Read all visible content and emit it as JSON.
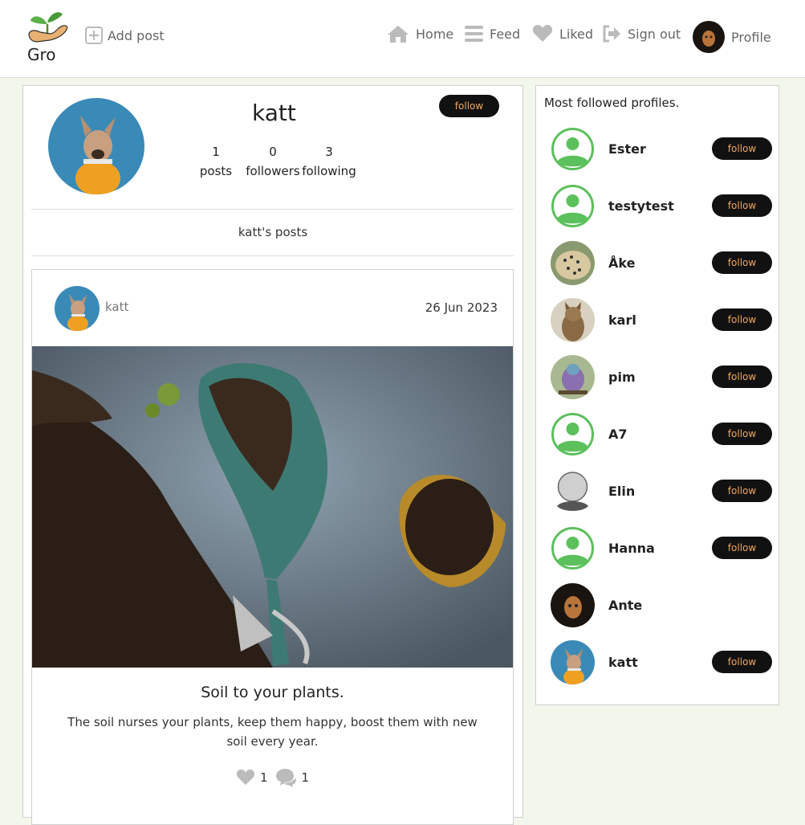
{
  "nav": {
    "logo_text": "Gro",
    "add_post": "Add post",
    "home": "Home",
    "feed": "Feed",
    "liked": "Liked",
    "sign_out": "Sign out",
    "profile": "Profile"
  },
  "profile": {
    "username": "katt",
    "follow_label": "follow",
    "stats": [
      {
        "value": "1",
        "label": "posts"
      },
      {
        "value": "0",
        "label": "followers"
      },
      {
        "value": "3",
        "label": "following"
      }
    ],
    "posts_heading": "katt's posts"
  },
  "post": {
    "author": "katt",
    "date": "26 Jun 2023",
    "title": "Soil to your plants.",
    "body": "The soil nurses your plants, keep them happy, boost them with new soil every year.",
    "likes": "1",
    "comments": "1"
  },
  "sidebar": {
    "title": "Most followed profiles.",
    "follow_label": "follow",
    "profiles": [
      {
        "name": "Ester",
        "avatar": "default-avatar",
        "follow": true
      },
      {
        "name": "testytest",
        "avatar": "default-avatar",
        "follow": true
      },
      {
        "name": "Åke",
        "avatar": "leopard-photo",
        "follow": true
      },
      {
        "name": "karl",
        "avatar": "cat-photo",
        "follow": true
      },
      {
        "name": "pim",
        "avatar": "bird-photo",
        "follow": true
      },
      {
        "name": "A7",
        "avatar": "default-avatar",
        "follow": true
      },
      {
        "name": "Elin",
        "avatar": "grey-avatar",
        "follow": true
      },
      {
        "name": "Hanna",
        "avatar": "default-avatar",
        "follow": true
      },
      {
        "name": "Ante",
        "avatar": "dark-photo",
        "follow": false
      },
      {
        "name": "katt",
        "avatar": "dog-photo",
        "follow": true
      }
    ]
  },
  "colors": {
    "accent_green": "#5cc05c",
    "page_bg": "#f3f6ea",
    "button_bg": "#111111",
    "button_text": "#f0a860"
  }
}
